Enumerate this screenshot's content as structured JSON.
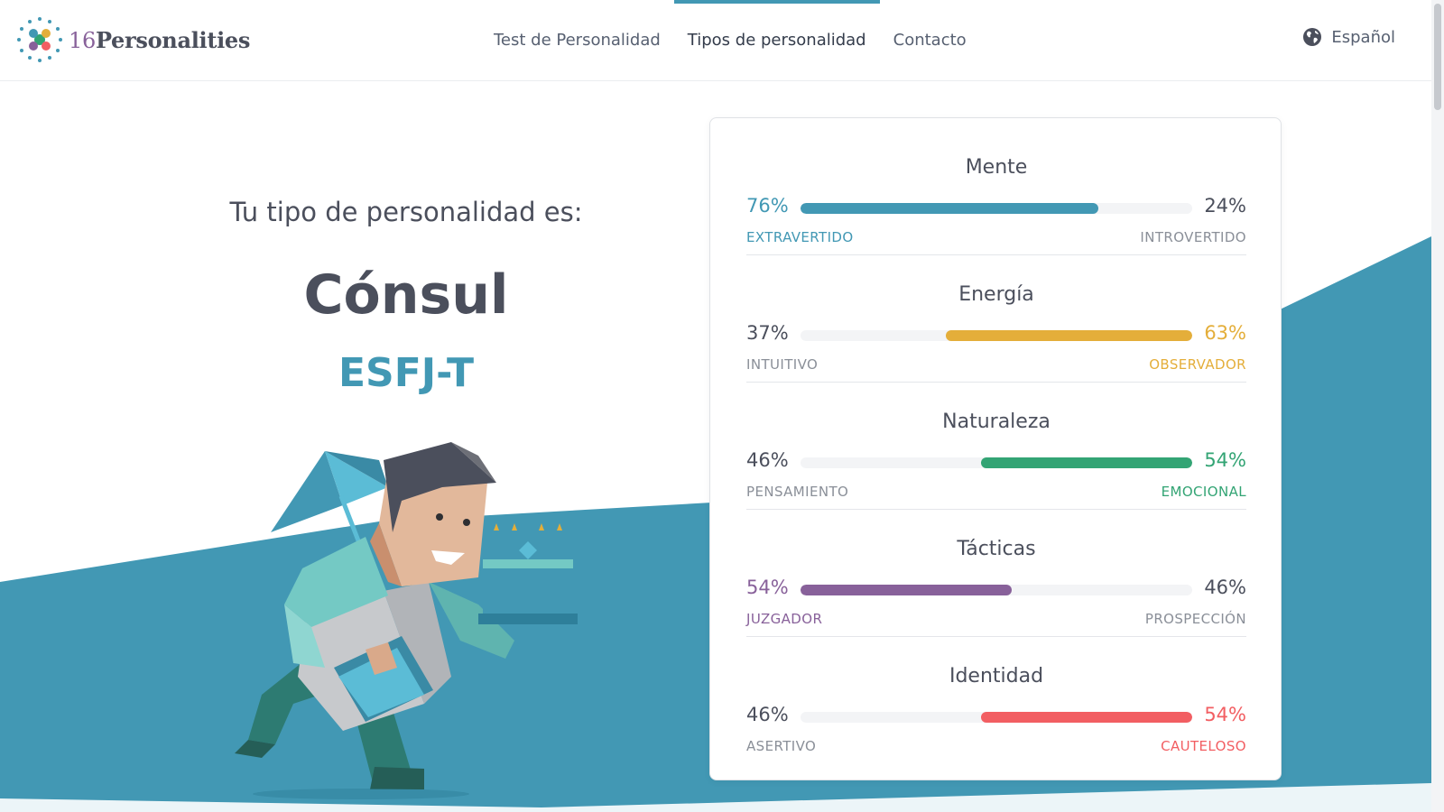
{
  "header": {
    "logo_number": "16",
    "logo_word": "Personalities",
    "nav": [
      {
        "label": "Test de Personalidad",
        "active": false
      },
      {
        "label": "Tipos de personalidad",
        "active": true
      },
      {
        "label": "Contacto",
        "active": false
      }
    ],
    "language": "Español"
  },
  "hero": {
    "subtitle": "Tu tipo de personalidad es:",
    "type_name": "Cónsul",
    "type_code": "ESFJ-T"
  },
  "traits": [
    {
      "title": "Mente",
      "left_pct": "76%",
      "right_pct": "24%",
      "left_label": "EXTRAVERTIDO",
      "right_label": "INTROVERTIDO",
      "dominant": "left",
      "value": 76,
      "color": "#4298b4"
    },
    {
      "title": "Energía",
      "left_pct": "37%",
      "right_pct": "63%",
      "left_label": "INTUITIVO",
      "right_label": "OBSERVADOR",
      "dominant": "right",
      "value": 63,
      "color": "#e4ae3a"
    },
    {
      "title": "Naturaleza",
      "left_pct": "46%",
      "right_pct": "54%",
      "left_label": "PENSAMIENTO",
      "right_label": "EMOCIONAL",
      "dominant": "right",
      "value": 54,
      "color": "#33a474"
    },
    {
      "title": "Tácticas",
      "left_pct": "54%",
      "right_pct": "46%",
      "left_label": "JUZGADOR",
      "right_label": "PROSPECCIÓN",
      "dominant": "left",
      "value": 54,
      "color": "#88619a"
    },
    {
      "title": "Identidad",
      "left_pct": "46%",
      "right_pct": "54%",
      "left_label": "ASERTIVO",
      "right_label": "CAUTELOSO",
      "dominant": "right",
      "value": 54,
      "color": "#f25e62"
    }
  ],
  "colors": {
    "accent": "#4298b4",
    "text": "#4b4f5c",
    "muted": "#8a8f98"
  }
}
